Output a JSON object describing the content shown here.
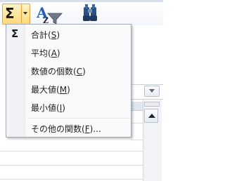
{
  "ribbon": {
    "autosum_icon": "sigma-icon",
    "sort_filter_icon": "sort-filter-icon",
    "find_select_icon": "find-select-icon"
  },
  "menu": {
    "items": [
      {
        "name": "sum",
        "icon": "Σ",
        "label": "合計",
        "accel": "S"
      },
      {
        "name": "average",
        "icon": "",
        "label": "平均",
        "accel": "A"
      },
      {
        "name": "count-numbers",
        "icon": "",
        "label": "数値の個数",
        "accel": "C"
      },
      {
        "name": "max",
        "icon": "",
        "label": "最大値",
        "accel": "M"
      },
      {
        "name": "min",
        "icon": "",
        "label": "最小値",
        "accel": "I"
      },
      {
        "name": "more-functions",
        "icon": "",
        "label": "その他の関数",
        "accel": "F",
        "suffix": "..."
      }
    ]
  },
  "colors": {
    "autosum_highlight": "#ffd97a",
    "autosum_border": "#e2a743",
    "menu_bg": "#fafafa"
  }
}
